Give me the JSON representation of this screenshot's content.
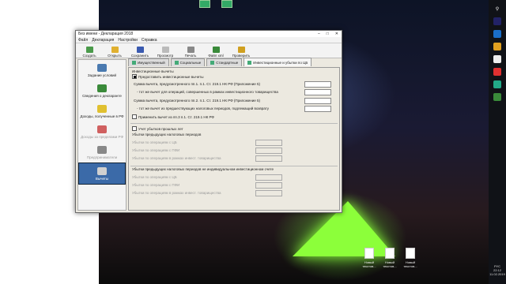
{
  "window": {
    "title": "Без имени - Декларация 2018",
    "controls": [
      "–",
      "□",
      "✕"
    ]
  },
  "menu": [
    "Файл",
    "Декларация",
    "Настройки",
    "Справка"
  ],
  "toolbar": [
    {
      "label": "Создать",
      "color": "#4a9a4a"
    },
    {
      "label": "Открыть",
      "color": "#e0b030"
    },
    {
      "label": "Сохранить",
      "color": "#3a5ab0"
    },
    {
      "label": "Просмотр",
      "color": "#bbbbbb"
    },
    {
      "label": "Печать",
      "color": "#888888"
    },
    {
      "label": "Файл xml",
      "color": "#3a8a3a"
    },
    {
      "label": "Проверить",
      "color": "#d0a020"
    }
  ],
  "tabs": [
    "Имущественный",
    "Социальные",
    "Стандартные",
    "Инвестиционные и убытки по ЦБ"
  ],
  "sidebar": [
    {
      "label": "Задание условий",
      "state": "normal",
      "color": "#4a7ab0"
    },
    {
      "label": "Сведения о декларанте",
      "state": "normal",
      "color": "#3a8a3a"
    },
    {
      "label": "Доходы, полученные в РФ",
      "state": "normal",
      "color": "#e0c030"
    },
    {
      "label": "Доходы за пределами РФ",
      "state": "dim",
      "color": "#d06060"
    },
    {
      "label": "Предприниматели",
      "state": "dim",
      "color": "#888888"
    },
    {
      "label": "Вычеты",
      "state": "selected",
      "color": "#d0d0d0"
    }
  ],
  "content": {
    "section_title": "Инвестиционные вычеты",
    "provide_checkbox": "Предоставить инвестиционные вычеты",
    "row1": "Сумма вычета, предусмотренного пп.1. п.1. Ст. 219.1 НК РФ (Приложение 5)",
    "row2": "- тот же вычет для операций, совершенных в рамках инвестиционного товарищества",
    "row3": "Сумма вычета, предусмотренного пп.2. п.1. Ст. 219.1 НК РФ (Приложение 5)",
    "row4": "- тот же вычет из предшествующих налоговых периодов, подлежащий возврату",
    "row5": "Применить вычет из пп.3 п.1. Ст. 219.1 НК РФ",
    "losses_checkbox": "Учет убытков прошлых лет",
    "group1_title": "Убытки предыдущих налоговых периодов",
    "group1_rows": [
      "Убытки по операциям с ЦБ",
      "Убытки по операциям с ПФИ",
      "Убытки по операциям в рамках инвест. товарищества"
    ],
    "group2_title": "Убытки предыдущих налоговых периодов не индивидуальном инвестиционном счете",
    "group2_rows": [
      "Убытки по операциям с ЦБ",
      "Убытки по операциям с ПФИ",
      "Убытки по операциям в рамках инвест. товарищества"
    ]
  },
  "desktop": {
    "icons": [
      "Новый текстов...",
      "Новый текстов...",
      "Новый текстов..."
    ],
    "clock_time": "22:12",
    "clock_date": "11.02.2019",
    "lang": "РУС"
  }
}
